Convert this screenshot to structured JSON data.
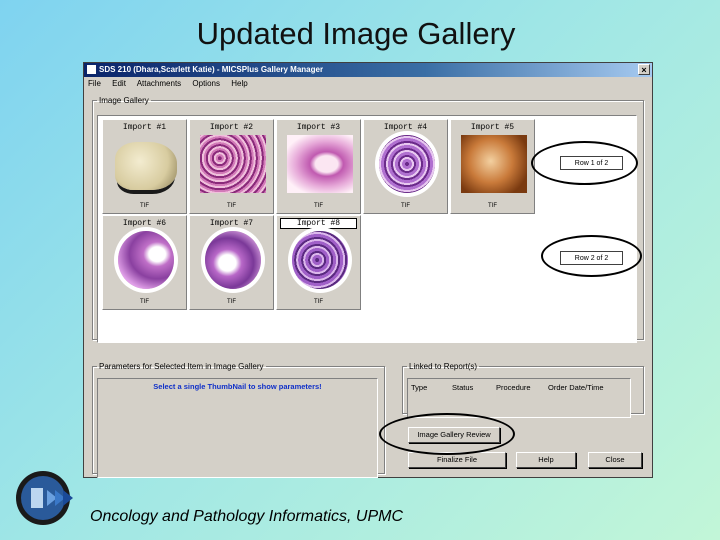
{
  "slide": {
    "title": "Updated Image Gallery",
    "footer": "Oncology and Pathology Informatics, UPMC"
  },
  "window": {
    "title": "SDS 210 (Dhara,Scarlett Katie) - MICSPlus Gallery Manager",
    "close_label": "×",
    "menu": [
      "File",
      "Edit",
      "Attachments",
      "Options",
      "Help"
    ]
  },
  "gallery": {
    "legend": "Image Gallery",
    "thumbs": [
      {
        "label": "Import #1",
        "format": "TIF",
        "icon": "gross-specimen-image"
      },
      {
        "label": "Import #2",
        "format": "TIF",
        "icon": "histology-image"
      },
      {
        "label": "Import #3",
        "format": "TIF",
        "icon": "histology-image"
      },
      {
        "label": "Import #4",
        "format": "TIF",
        "icon": "histology-image"
      },
      {
        "label": "Import #5",
        "format": "TIF",
        "icon": "endoscopy-image"
      },
      {
        "label": "Import #6",
        "format": "TIF",
        "icon": "histology-image"
      },
      {
        "label": "Import #7",
        "format": "TIF",
        "icon": "histology-image"
      },
      {
        "label": "Import #8",
        "format": "TIF",
        "icon": "histology-image"
      }
    ],
    "row1_button": "Row 1 of 2",
    "row2_button": "Row 2 of 2"
  },
  "params": {
    "legend": "Parameters for Selected Item in Image Gallery",
    "message": "Select a single ThumbNail to show parameters!"
  },
  "linked": {
    "legend": "Linked to Report(s)",
    "columns": [
      "Type",
      "Status",
      "Procedure",
      "Order Date/Time"
    ]
  },
  "buttons": {
    "review": "Image Gallery Review",
    "finalize": "Finalize File",
    "help": "Help",
    "close": "Close"
  },
  "colors": {
    "window_face": "#d4d0c8",
    "titlebar": "#0a246a",
    "param_text": "#1030c8"
  }
}
